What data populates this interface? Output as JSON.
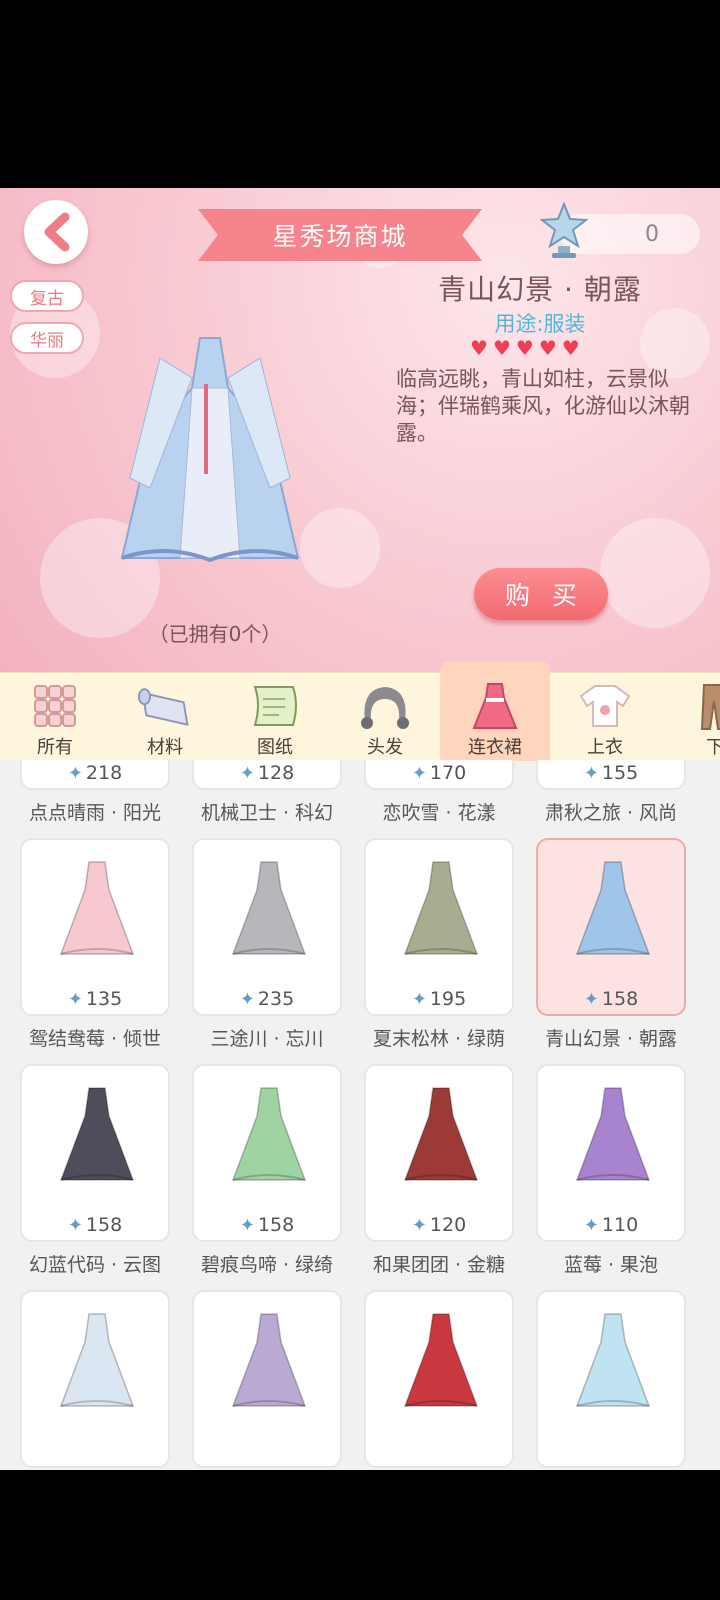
{
  "header": {
    "title": "星秀场商城",
    "star_count": "0",
    "tags": [
      "复古",
      "华丽"
    ],
    "item_name": "青山幻景 · 朝露",
    "usage_label": "用途:",
    "usage_value": "服装",
    "hearts": 5,
    "description": "临高远眺，青山如柱，云景似海；伴瑞鹤乘风，化游仙以沐朝露。",
    "buy_label": "购买",
    "owned_text": "（已拥有0个）"
  },
  "categories": [
    {
      "label": "所有",
      "icon": "grid-icon"
    },
    {
      "label": "材料",
      "icon": "fabric-roll-icon"
    },
    {
      "label": "图纸",
      "icon": "scroll-icon"
    },
    {
      "label": "头发",
      "icon": "hair-icon"
    },
    {
      "label": "连衣裙",
      "icon": "dress-icon",
      "active": true
    },
    {
      "label": "上衣",
      "icon": "shirt-icon"
    },
    {
      "label": "下",
      "icon": "pants-icon"
    }
  ],
  "items": [
    {
      "name": "点点晴雨 · 阳光",
      "price": "218",
      "color": "#f3c3cf"
    },
    {
      "name": "机械卫士 · 科幻",
      "price": "128",
      "color": "#c9cde0"
    },
    {
      "name": "恋吹雪 · 花漾",
      "price": "170",
      "color": "#f4e2e8"
    },
    {
      "name": "肃秋之旅 · 风尚",
      "price": "155",
      "color": "#d9c6a8"
    },
    {
      "name": "鸳结鸯莓 · 倾世",
      "price": "135",
      "color": "#f7c8cf"
    },
    {
      "name": "三途川 · 忘川",
      "price": "235",
      "color": "#b7b6bb"
    },
    {
      "name": "夏末松林 · 绿荫",
      "price": "195",
      "color": "#a7ad8f"
    },
    {
      "name": "青山幻景 · 朝露",
      "price": "158",
      "color": "#9fc6ea",
      "selected": true
    },
    {
      "name": "幻蓝代码 · 云图",
      "price": "158",
      "color": "#4d4d5c"
    },
    {
      "name": "碧痕鸟啼 · 绿绮",
      "price": "158",
      "color": "#9fd3a3"
    },
    {
      "name": "和果团团 · 金糖",
      "price": "120",
      "color": "#9b3a36"
    },
    {
      "name": "蓝莓 · 果泡",
      "price": "110",
      "color": "#a883cf"
    },
    {
      "name": "",
      "price": "",
      "color": "#dbe6f3"
    },
    {
      "name": "",
      "price": "",
      "color": "#b9a9d3"
    },
    {
      "name": "",
      "price": "",
      "color": "#c9383e"
    },
    {
      "name": "",
      "price": "",
      "color": "#bfe3f0"
    }
  ]
}
